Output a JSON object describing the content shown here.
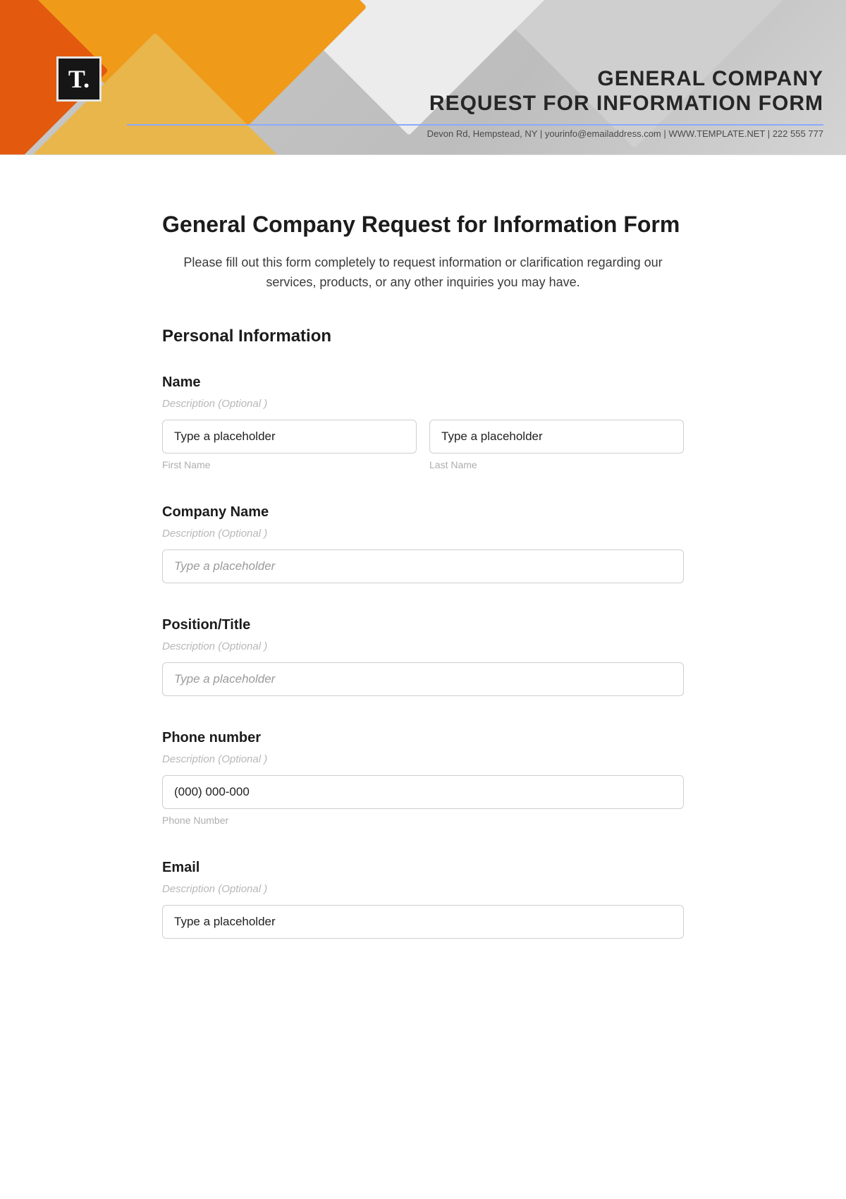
{
  "banner": {
    "logo_text": "T.",
    "title_line1": "GENERAL COMPANY",
    "title_line2": "REQUEST FOR INFORMATION FORM",
    "subline": "Devon Rd, Hempstead, NY | yourinfo@emailaddress.com | WWW.TEMPLATE.NET | 222 555 777"
  },
  "page": {
    "title": "General Company Request for Information Form",
    "description": "Please fill out this form completely to request information or clarification regarding our services, products, or any other inquiries you may have."
  },
  "section": {
    "personal_info": "Personal Information"
  },
  "fields": {
    "name": {
      "label": "Name",
      "desc": "Description  (Optional )",
      "first_placeholder": "Type a placeholder",
      "last_placeholder": "Type a placeholder",
      "first_sub": "First Name",
      "last_sub": "Last Name"
    },
    "company": {
      "label": "Company Name",
      "desc": "Description  (Optional )",
      "placeholder": "Type a placeholder"
    },
    "position": {
      "label": "Position/Title",
      "desc": "Description  (Optional )",
      "placeholder": "Type a placeholder"
    },
    "phone": {
      "label": "Phone number",
      "desc": "Description  (Optional )",
      "placeholder": "(000) 000-000",
      "sub": "Phone Number"
    },
    "email": {
      "label": "Email",
      "desc": "Description  (Optional )",
      "placeholder": "Type a placeholder"
    }
  }
}
